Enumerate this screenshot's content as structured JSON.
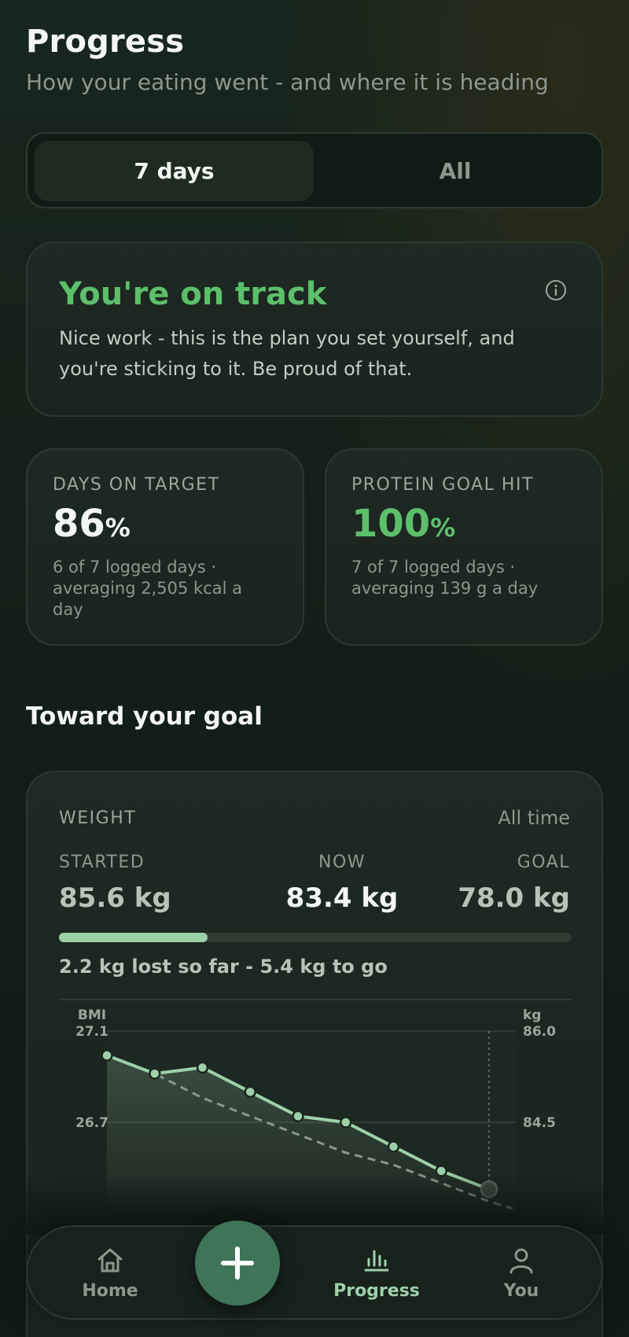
{
  "header": {
    "title": "Progress",
    "subtitle": "How your eating went - and where it is heading"
  },
  "range_toggle": {
    "options": [
      "7 days",
      "All"
    ],
    "selected": "7 days"
  },
  "status_card": {
    "title": "You're on track",
    "message": "Nice work - this is the plan you set yourself, and you're sticking to it. Be proud of that.",
    "icon": "info-icon",
    "accent_color": "#5cbf6a"
  },
  "stats": {
    "days_on_target": {
      "label": "DAYS ON TARGET",
      "value": "86",
      "unit": "%",
      "note": "6 of 7 logged days · averaging 2,505 kcal a day"
    },
    "protein_goal": {
      "label": "PROTEIN GOAL HIT",
      "value": "100",
      "unit": "%",
      "note": "7 of 7 logged days · averaging 139 g a day"
    }
  },
  "goal_section": {
    "title": "Toward your goal"
  },
  "weight": {
    "label": "WEIGHT",
    "range": "All time",
    "started_label": "STARTED",
    "now_label": "NOW",
    "goal_label": "GOAL",
    "started": "85.6 kg",
    "now": "83.4 kg",
    "goal": "78.0 kg",
    "progress_fraction": 0.29,
    "summary": "2.2 kg lost so far - 5.4 kg to go"
  },
  "chart_data": {
    "type": "line",
    "left_axis_label": "BMI",
    "right_axis_label": "kg",
    "left_ticks": [
      "27.1",
      "26.7"
    ],
    "right_ticks": [
      "86.0",
      "84.5"
    ],
    "ylim": [
      83.4,
      86.0
    ],
    "series": [
      {
        "values": [
          85.6,
          85.3,
          85.4,
          85.0,
          84.6,
          84.5,
          84.1,
          83.7,
          83.4
        ]
      }
    ],
    "trend": [
      85.6,
      85.3,
      84.9,
      84.6,
      84.3,
      84.0,
      83.8,
      83.5,
      83.2
    ],
    "colors": {
      "line": "#9ed0a8",
      "trend": "#8a968e"
    }
  },
  "nav": {
    "home": "Home",
    "progress": "Progress",
    "you": "You",
    "active": "Progress",
    "icons": [
      "home-icon",
      "plus-icon",
      "bar-chart-icon",
      "person-icon"
    ]
  }
}
